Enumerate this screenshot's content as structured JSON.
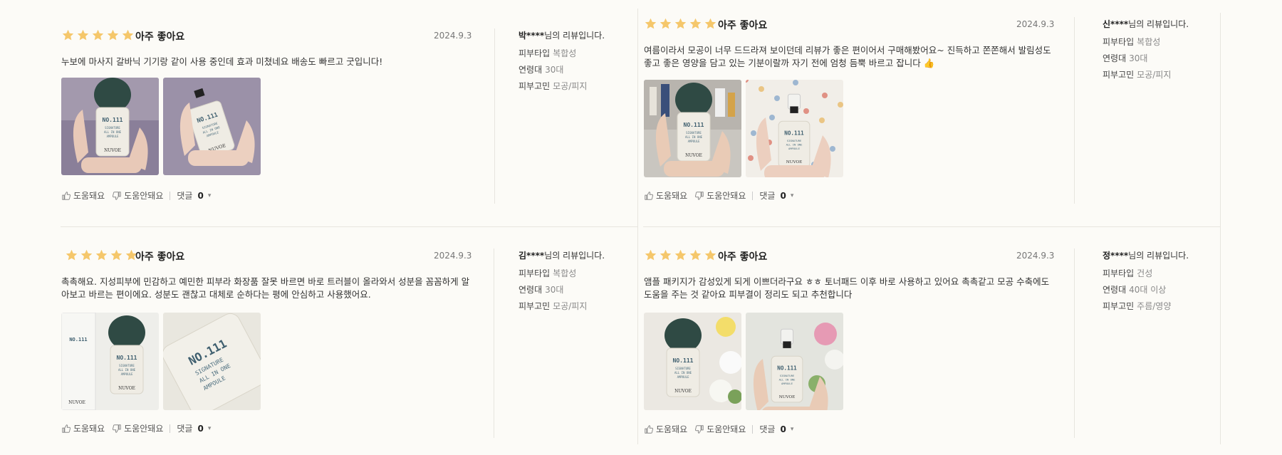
{
  "colors": {
    "star": "#f5c76b",
    "divider": "#e7e5df",
    "bg": "#fcfbf7"
  },
  "reviews": [
    {
      "stars": 5,
      "title": "아주 좋아요",
      "date": "2024.9.3",
      "body": "누보에 마사지 갈바닉 기기랑 같이 사용 중인데 효과 미쳤네요 배송도 빠르고 굿입니다!",
      "helpful_label": "도움돼요",
      "unhelpful_label": "도움안돼요",
      "comment_label": "댓글",
      "comment_count": "0",
      "reviewer_masked": "박****",
      "reviewer_suffix": "님의 리뷰입니다.",
      "skin_type_key": "피부타입",
      "skin_type": "복합성",
      "age_key": "연령대",
      "age": "30대",
      "concern_key": "피부고민",
      "concern": "모공/피지",
      "photos": [
        "photo-hand-ampoule",
        "photo-hand-ampoule-back"
      ]
    },
    {
      "stars": 5,
      "title": "아주 좋아요",
      "date": "2024.9.3",
      "body": "여름이라서 모공이 너무 드드라져 보이던데 리뷰가 좋은 편이어서 구매해봤어요~ 진득하고 쫀쫀해서 발림성도 좋고 좋은 영양을 담고 있는 기분이랄까 자기 전에 엄청 듬뿍 바르고 잡니다 👍",
      "helpful_label": "도움돼요",
      "unhelpful_label": "도움안돼요",
      "comment_label": "댓글",
      "comment_count": "0",
      "reviewer_masked": "신****",
      "reviewer_suffix": "님의 리뷰입니다.",
      "skin_type_key": "피부타입",
      "skin_type": "복합성",
      "age_key": "연령대",
      "age": "30대",
      "concern_key": "피부고민",
      "concern": "모공/피지",
      "photos": [
        "photo-ampoule-shelf",
        "photo-ampoule-floral"
      ]
    },
    {
      "stars": 5,
      "title": "아주 좋아요",
      "date": "2024.9.3",
      "body": "촉촉해요. 지성피부에 민감하고 예민한 피부라 화장품 잘못 바르면 바로 트러블이 올라와서 성분을 꼼꼼하게 알아보고 바르는 편이에요. 성분도 괜찮고 대체로 순하다는 평에 안심하고 사용했어요.",
      "helpful_label": "도움돼요",
      "unhelpful_label": "도움안돼요",
      "comment_label": "댓글",
      "comment_count": "0",
      "reviewer_masked": "김****",
      "reviewer_suffix": "님의 리뷰입니다.",
      "skin_type_key": "피부타입",
      "skin_type": "복합성",
      "age_key": "연령대",
      "age": "30대",
      "concern_key": "피부고민",
      "concern": "모공/피지",
      "photos": [
        "photo-ampoule-box",
        "photo-ampoule-closeup"
      ]
    },
    {
      "stars": 5,
      "title": "아주 좋아요",
      "date": "2024.9.3",
      "body": "앰플 패키지가 감성있게 되게 이쁘더라구요 ㅎㅎ 토너패드 이후 바로 사용하고 있어요 촉촉같고 모공 수축에도 도움을 주는 것 같아요 피부결이 정리도 되고 추천합니다",
      "helpful_label": "도움돼요",
      "unhelpful_label": "도움안돼요",
      "comment_label": "댓글",
      "comment_count": "0",
      "reviewer_masked": "정****",
      "reviewer_suffix": "님의 리뷰입니다.",
      "skin_type_key": "피부타입",
      "skin_type": "건성",
      "age_key": "연령대",
      "age": "40대 이상",
      "concern_key": "피부고민",
      "concern": "주름/영양",
      "photos": [
        "photo-ampoule-flowers",
        "photo-ampoule-flowers-open"
      ]
    }
  ],
  "photo_labels": {
    "brand": "NUVOE",
    "product_lines": [
      "NO.111",
      "SIGNATURE",
      "ALL IN ONE",
      "AMPOULE"
    ]
  }
}
